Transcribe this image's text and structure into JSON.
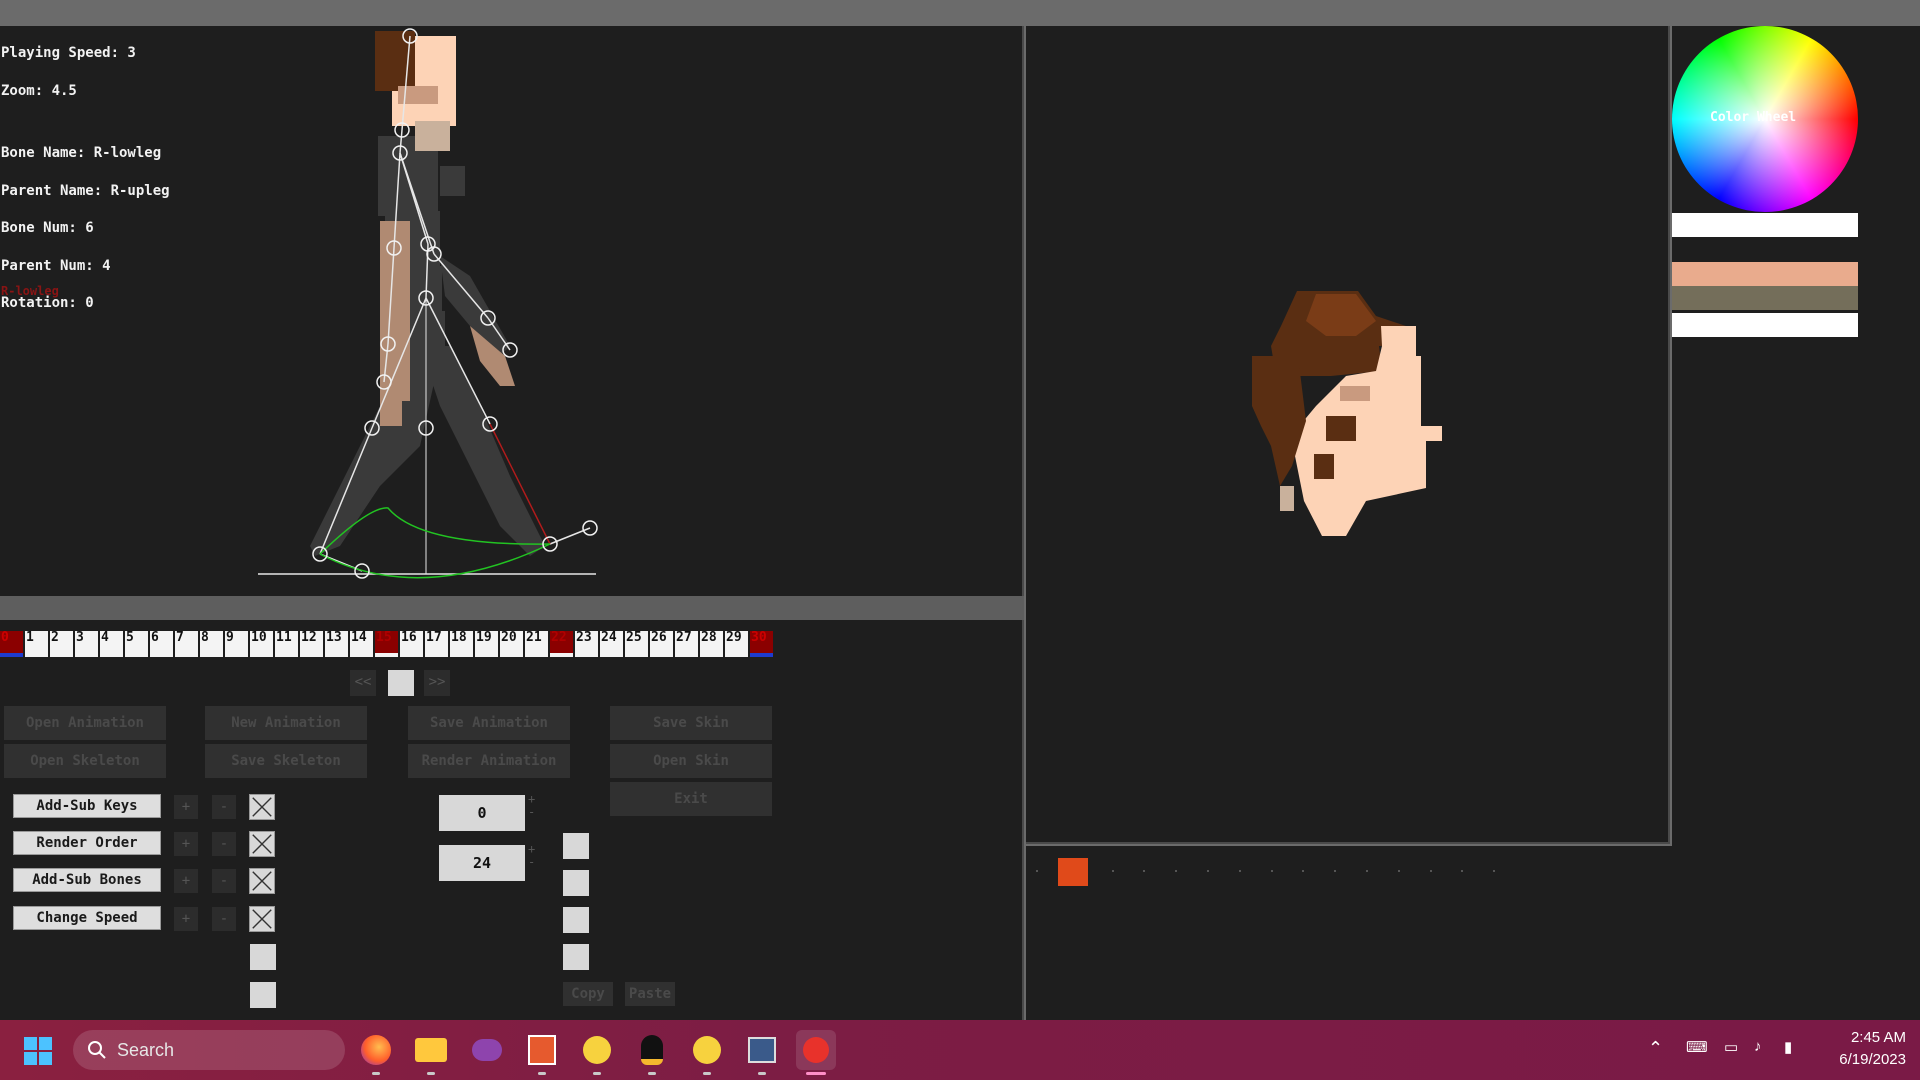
{
  "viewport": {
    "info_lines": [
      "Playing Speed: 3",
      "Zoom: 4.5",
      "",
      "Bone Name: R-lowleg",
      "Parent Name: R-upleg",
      "Bone Num: 6",
      "Parent Num: 4",
      "Rotation: 0"
    ],
    "selected_bone_label": "R-lowleg"
  },
  "timeline": {
    "frames": [
      "0",
      "1",
      "2",
      "3",
      "4",
      "5",
      "6",
      "7",
      "8",
      "9",
      "10",
      "11",
      "12",
      "13",
      "14",
      "15",
      "16",
      "17",
      "18",
      "19",
      "20",
      "21",
      "22",
      "23",
      "24",
      "25",
      "26",
      "27",
      "28",
      "29",
      "30"
    ],
    "key_frames": [
      0,
      15,
      22,
      30
    ],
    "prev_label": "<<",
    "next_label": ">>"
  },
  "buttons": {
    "open_animation": "Open Animation",
    "new_animation": "New Animation",
    "save_animation": "Save Animation",
    "save_skin": "Save Skin",
    "open_skeleton": "Open Skeleton",
    "save_skeleton": "Save Skeleton",
    "render_animation": "Render Animation",
    "open_skin": "Open Skin",
    "exit": "Exit",
    "copy": "Copy",
    "paste": "Paste"
  },
  "toggles": [
    {
      "label": "Add-Sub Keys"
    },
    {
      "label": "Render Order"
    },
    {
      "label": "Add-Sub Bones"
    },
    {
      "label": "Change Speed"
    }
  ],
  "plus": "+",
  "minus": "-",
  "fields": {
    "first_value": "0",
    "second_value": "24"
  },
  "palette": {
    "wheel_label": "Color Wheel",
    "swatches": [
      "#ffffff",
      "#e9ab8d",
      "#746e5a",
      "#ffffff"
    ]
  },
  "taskbar": {
    "search_placeholder": "Search",
    "time": "2:45 AM",
    "date": "6/19/2023",
    "pinned_icons": [
      "firefox-icon",
      "file-explorer-icon",
      "mask-app-icon",
      "calendar-app-icon",
      "pikachu-app-icon",
      "linux-penguin-icon",
      "pikachu-app-2-icon",
      "monitor-app-icon",
      "animator-app-icon"
    ]
  },
  "colors": {
    "accent_green": "#22c322",
    "bone_white": "#e6e6e6",
    "bone_red": "#b01c1c",
    "skin": "#fdd3b6",
    "hair": "#6b3515"
  }
}
